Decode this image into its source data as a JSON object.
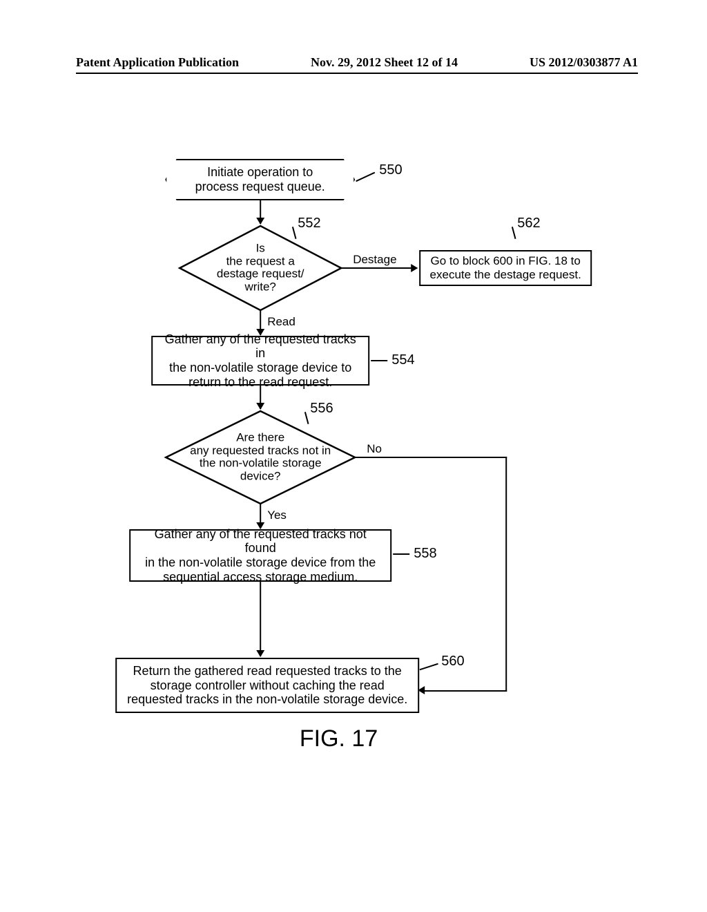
{
  "header": {
    "left": "Patent Application Publication",
    "center": "Nov. 29, 2012  Sheet 12 of 14",
    "right": "US 2012/0303877 A1"
  },
  "nodes": {
    "n550": "Initiate operation to\nprocess request queue.",
    "n552": "Is\nthe request a\ndestage request/\nwrite?",
    "n554": "Gather any of the requested tracks in\nthe non-volatile storage device to\nreturn to the read request.",
    "n556": "Are there\nany requested tracks not in\nthe non-volatile storage\ndevice?",
    "n558": "Gather any of the requested tracks not found\nin the non-volatile storage device from the\nsequential access storage medium.",
    "n560": "Return the gathered read requested tracks to the\nstorage controller without caching the read\nrequested tracks in the non-volatile storage device.",
    "n562": "Go to block 600 in FIG. 18 to\nexecute the destage request."
  },
  "refs": {
    "r550": "550",
    "r552": "552",
    "r554": "554",
    "r556": "556",
    "r558": "558",
    "r560": "560",
    "r562": "562"
  },
  "edges": {
    "destage": "Destage",
    "read": "Read",
    "no": "No",
    "yes": "Yes"
  },
  "figure": "FIG. 17"
}
